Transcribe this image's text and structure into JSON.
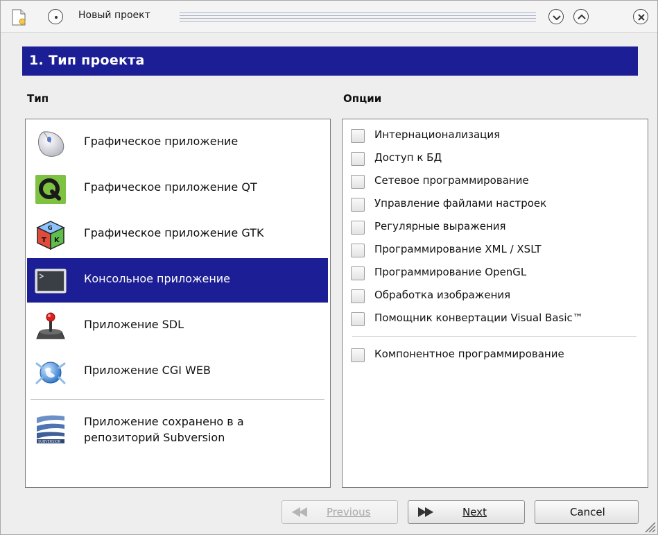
{
  "window": {
    "title": "Новый проект",
    "icons": {
      "app": "document-icon",
      "menu": "window-menu-icon",
      "minimize": "minimize-icon",
      "maximize": "maximize-icon",
      "close": "close-icon"
    }
  },
  "page": {
    "header": "1. Тип проекта"
  },
  "types": {
    "label": "Тип",
    "items": [
      {
        "label": "Графическое приложение",
        "icon": "mouse-icon",
        "selected": false
      },
      {
        "label": "Графическое приложение QT",
        "icon": "qt-logo-icon",
        "selected": false
      },
      {
        "label": "Графическое приложение GTK",
        "icon": "gtk-logo-icon",
        "selected": false
      },
      {
        "label": "Консольное приложение",
        "icon": "console-icon",
        "selected": true
      },
      {
        "label": "Приложение SDL",
        "icon": "joystick-icon",
        "selected": false
      },
      {
        "label": "Приложение CGI WEB",
        "icon": "web-globe-icon",
        "selected": false
      }
    ],
    "svn": {
      "line1": "Приложение сохранено в а",
      "line2": "репозиторий Subversion",
      "icon": "subversion-logo-icon"
    }
  },
  "options": {
    "label": "Опции",
    "items": [
      {
        "label": "Интернационализация",
        "checked": false
      },
      {
        "label": "Доступ к БД",
        "checked": false
      },
      {
        "label": "Сетевое программирование",
        "checked": false
      },
      {
        "label": "Управление файлами настроек",
        "checked": false
      },
      {
        "label": "Регулярные выражения",
        "checked": false
      },
      {
        "label": "Программирование XML / XSLT",
        "checked": false
      },
      {
        "label": "Программирование OpenGL",
        "checked": false
      },
      {
        "label": "Обработка изображения",
        "checked": false
      },
      {
        "label": "Помощник конвертации Visual Basic™",
        "checked": false
      }
    ],
    "extra": {
      "label": "Компонентное программирование",
      "checked": false
    }
  },
  "buttons": {
    "previous": {
      "label": "Previous",
      "enabled": false
    },
    "next": {
      "label": "Next",
      "enabled": true
    },
    "cancel": {
      "label": "Cancel",
      "enabled": true
    }
  },
  "colors": {
    "accent": "#1c1e95",
    "selection_text": "#ffffff"
  }
}
